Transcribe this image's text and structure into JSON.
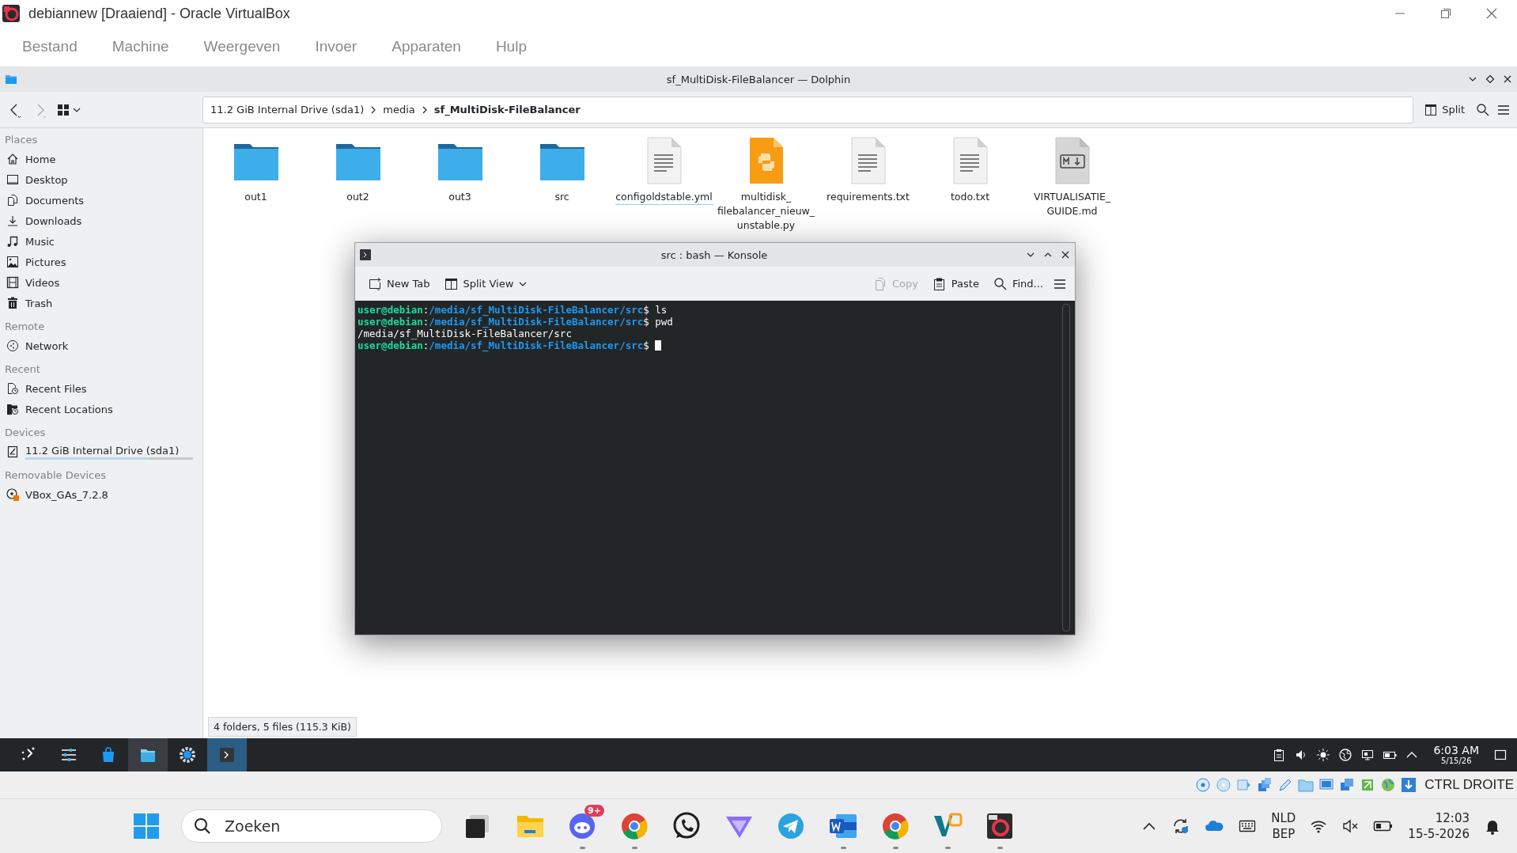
{
  "vbox_window": {
    "title": "debiannew [Draaiend] - Oracle VirtualBox",
    "menu": [
      "Bestand",
      "Machine",
      "Weergeven",
      "Invoer",
      "Apparaten",
      "Hulp"
    ]
  },
  "dolphin": {
    "title": "sf_MultiDisk-FileBalancer — Dolphin",
    "breadcrumb": [
      {
        "label": "11.2 GiB Internal Drive (sda1)",
        "current": false
      },
      {
        "label": "media",
        "current": false
      },
      {
        "label": "sf_MultiDisk-FileBalancer",
        "current": true
      }
    ],
    "split_label": "Split",
    "sidebar": [
      {
        "heading": "Places",
        "items": [
          {
            "label": "Home",
            "kind": "home"
          },
          {
            "label": "Desktop",
            "kind": "desktop"
          },
          {
            "label": "Documents",
            "kind": "documents"
          },
          {
            "label": "Downloads",
            "kind": "downloads"
          },
          {
            "label": "Music",
            "kind": "music"
          },
          {
            "label": "Pictures",
            "kind": "pictures"
          },
          {
            "label": "Videos",
            "kind": "videos"
          },
          {
            "label": "Trash",
            "kind": "trash"
          }
        ]
      },
      {
        "heading": "Remote",
        "items": [
          {
            "label": "Network",
            "kind": "network"
          }
        ]
      },
      {
        "heading": "Recent",
        "items": [
          {
            "label": "Recent Files",
            "kind": "recent_files"
          },
          {
            "label": "Recent Locations",
            "kind": "recent_locations"
          }
        ]
      },
      {
        "heading": "Devices",
        "items": [
          {
            "label": "11.2 GiB Internal Drive (sda1)",
            "kind": "drive",
            "level": 0.74
          }
        ]
      },
      {
        "heading": "Removable Devices",
        "items": [
          {
            "label": "VBox_GAs_7.2.8",
            "kind": "optical"
          }
        ]
      }
    ],
    "files": [
      {
        "name": "out1",
        "kind": "folder",
        "hovered": false
      },
      {
        "name": "out2",
        "kind": "folder",
        "hovered": false
      },
      {
        "name": "out3",
        "kind": "folder",
        "hovered": false
      },
      {
        "name": "src",
        "kind": "folder",
        "hovered": false
      },
      {
        "name": "configoldstable.yml",
        "kind": "text",
        "hovered": true
      },
      {
        "name": "multidisk_ filebalancer_nieuw_ unstable.py",
        "kind": "python",
        "hovered": false
      },
      {
        "name": "requirements.txt",
        "kind": "text",
        "hovered": false
      },
      {
        "name": "todo.txt",
        "kind": "text",
        "hovered": false
      },
      {
        "name": "VIRTUALISATIE_ GUIDE.md",
        "kind": "markdown",
        "hovered": false
      }
    ],
    "status": "4 folders, 5 files (115.3 KiB)"
  },
  "konsole": {
    "title": "src : bash — Konsole",
    "toolbar": [
      {
        "label": "New Tab",
        "kind": "new_tab",
        "disabled": false
      },
      {
        "label": "Split View",
        "kind": "split_view",
        "disabled": false
      },
      {
        "label": "Copy",
        "kind": "copy",
        "disabled": true
      },
      {
        "label": "Paste",
        "kind": "paste",
        "disabled": false
      },
      {
        "label": "Find...",
        "kind": "find",
        "disabled": false
      }
    ],
    "lines": [
      {
        "segments": [
          {
            "kind": "user",
            "text": "user@debian"
          },
          {
            "kind": "plain",
            "text": ":"
          },
          {
            "kind": "path",
            "text": "/media/sf_MultiDisk-FileBalancer/src"
          },
          {
            "kind": "plain",
            "text": "$ ls"
          }
        ],
        "cursor": false
      },
      {
        "segments": [
          {
            "kind": "user",
            "text": "user@debian"
          },
          {
            "kind": "plain",
            "text": ":"
          },
          {
            "kind": "path",
            "text": "/media/sf_MultiDisk-FileBalancer/src"
          },
          {
            "kind": "plain",
            "text": "$ pwd"
          }
        ],
        "cursor": false
      },
      {
        "segments": [
          {
            "kind": "plain",
            "text": "/media/sf_MultiDisk-FileBalancer/src"
          }
        ],
        "cursor": false
      },
      {
        "segments": [
          {
            "kind": "user",
            "text": "user@debian"
          },
          {
            "kind": "plain",
            "text": ":"
          },
          {
            "kind": "path",
            "text": "/media/sf_MultiDisk-FileBalancer/src"
          },
          {
            "kind": "plain",
            "text": "$ "
          }
        ],
        "cursor": true
      }
    ]
  },
  "kde_panel": {
    "tasks": [
      {
        "kind": "launcher",
        "active": false
      },
      {
        "kind": "settings",
        "active": false
      },
      {
        "kind": "store",
        "active": false
      },
      {
        "kind": "files",
        "active": true
      },
      {
        "kind": "gear",
        "active": false
      },
      {
        "kind": "terminal",
        "active": true
      }
    ],
    "time": "6:03 AM",
    "date": "5/15/26"
  },
  "vbox_status": {
    "host_key": "CTRL DROITE"
  },
  "win_taskbar": {
    "search": {
      "placeholder": "Zoeken"
    },
    "apps": [
      {
        "kind": "task_view",
        "running": false
      },
      {
        "kind": "explorer",
        "running": false
      },
      {
        "kind": "chat",
        "running": true,
        "badge": "9+"
      },
      {
        "kind": "browser",
        "running": true
      },
      {
        "kind": "phone",
        "running": false
      },
      {
        "kind": "triangle",
        "running": false
      },
      {
        "kind": "plane",
        "running": false
      },
      {
        "kind": "word",
        "running": true
      },
      {
        "kind": "browser",
        "running": true
      },
      {
        "kind": "vlogo",
        "running": true
      },
      {
        "kind": "vbox",
        "running": true
      }
    ],
    "language": "NLD",
    "layout": "BEP",
    "time": "12:03",
    "date": "15-5-2026"
  }
}
